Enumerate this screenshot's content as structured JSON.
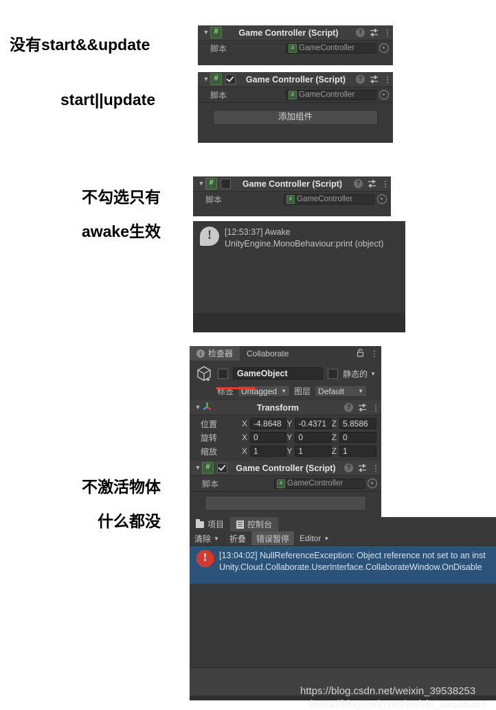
{
  "annotations": [
    {
      "id": "no-start-update",
      "text": "没有start&&update"
    },
    {
      "id": "start-or-update",
      "text": "start||update"
    },
    {
      "id": "unchecked-awake-line1",
      "text": "不勾选只有"
    },
    {
      "id": "unchecked-awake-line2",
      "text": "awake生效"
    },
    {
      "id": "inactive-object-line1",
      "text": "不激活物体"
    },
    {
      "id": "inactive-object-line2",
      "text": "什么都没"
    }
  ],
  "component_panel_1": {
    "title": "Game Controller (Script)",
    "script_label": "脚本",
    "script_value": "GameController",
    "has_enable_checkbox": false,
    "icons": {
      "foldout": "chevron-down-icon",
      "script": "csharp-script-icon",
      "help": "?",
      "preset": "preset-icon",
      "menu": "kebab-menu-icon"
    }
  },
  "component_panel_2": {
    "title": "Game Controller (Script)",
    "script_label": "脚本",
    "script_value": "GameController",
    "enabled": true,
    "add_component_label": "添加组件"
  },
  "component_panel_3": {
    "title": "Game Controller (Script)",
    "script_label": "脚本",
    "script_value": "GameController",
    "enabled": false
  },
  "console_log": {
    "icon": "info-log-icon",
    "line1": "[12:53:37] Awake",
    "line2": "UnityEngine.MonoBehaviour:print (object)"
  },
  "inspector": {
    "tabs": [
      {
        "label": "检查器",
        "icon": "info-icon",
        "active": true
      },
      {
        "label": "Collaborate",
        "icon": "",
        "active": false
      }
    ],
    "lock_icon": "lock-icon",
    "menu_icon": "kebab-menu-icon",
    "gameobject": {
      "icon": "cube-icon",
      "active_checkbox": false,
      "name": "GameObject",
      "static_checkbox": false,
      "static_label": "静态的"
    },
    "tag_row": {
      "tag_label": "标签",
      "tag_value": "Untagged",
      "layer_label": "图层",
      "layer_value": "Default"
    },
    "transform": {
      "title": "Transform",
      "icon": "transform-gizmo-icon",
      "rows": [
        {
          "label": "位置",
          "x": "-4.8648",
          "y": "-0.4371",
          "z": "5.8586"
        },
        {
          "label": "旋转",
          "x": "0",
          "y": "0",
          "z": "0"
        },
        {
          "label": "缩放",
          "x": "1",
          "y": "1",
          "z": "1"
        }
      ],
      "axis_labels": {
        "x": "X",
        "y": "Y",
        "z": "Z"
      }
    },
    "script_component": {
      "title": "Game Controller (Script)",
      "script_label": "脚本",
      "script_value": "GameController",
      "enabled": true
    }
  },
  "bottom_console": {
    "tabs": [
      {
        "label": "项目",
        "icon": "folder-icon",
        "active": false
      },
      {
        "label": "控制台",
        "icon": "console-icon",
        "active": true
      }
    ],
    "toolbar": [
      {
        "label": "清除",
        "icon": "",
        "pressed": false,
        "has_caret": true
      },
      {
        "label": "折叠",
        "icon": "",
        "pressed": false,
        "has_caret": false
      },
      {
        "label": "错误暂停",
        "icon": "",
        "pressed": true,
        "has_caret": false
      },
      {
        "label": "Editor",
        "icon": "",
        "pressed": false,
        "has_caret": true
      }
    ],
    "error": {
      "icon": "error-icon",
      "line1": "[13:04:02] NullReferenceException: Object reference not set to an inst",
      "line2": "Unity.Cloud.Collaborate.UserInterface.CollaborateWindow.OnDisable"
    }
  },
  "watermark": {
    "text": "https://blog.csdn.net/weixin_39538253",
    "ghost_text": "https://blog.csdn.net/weixin_39538253"
  },
  "colors": {
    "panel_bg": "#393939",
    "header_bg": "#3f3f3f",
    "field_bg": "#2b2b2b",
    "selection_blue": "#2b5278",
    "error_red": "#d03a2f",
    "script_green": "#9ede92",
    "annotation_red": "#e03e2e"
  }
}
